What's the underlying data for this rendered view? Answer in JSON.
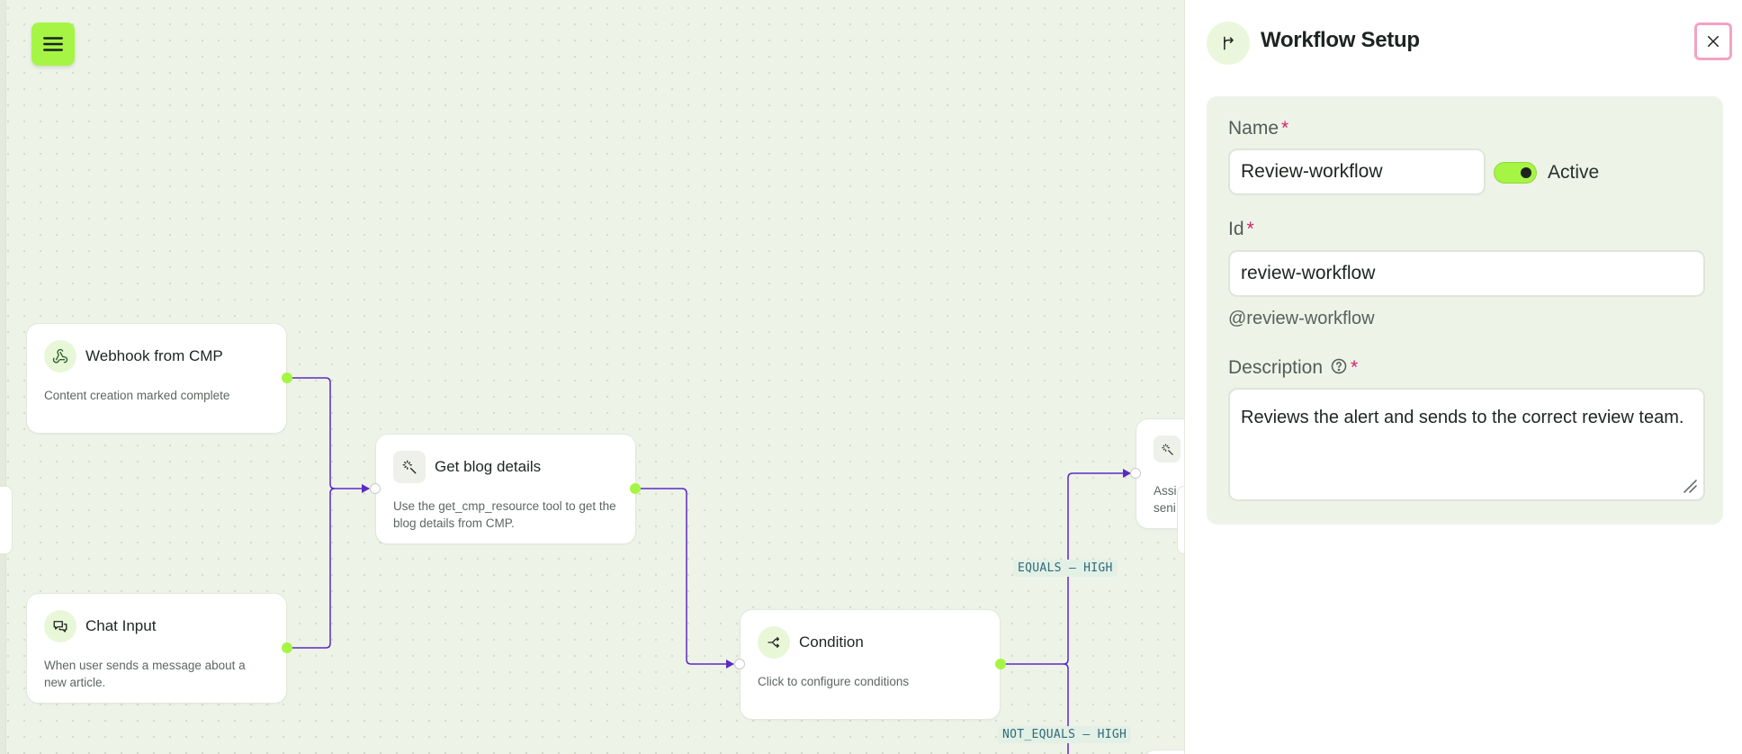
{
  "canvas": {
    "nodes": [
      {
        "id": "webhook",
        "title": "Webhook from CMP",
        "description": "Content creation marked complete",
        "icon": "webhook-icon"
      },
      {
        "id": "blog",
        "title": "Get blog details",
        "description": "Use the get_cmp_resource tool to get the blog details from CMP.",
        "icon": "wand-icon"
      },
      {
        "id": "chat",
        "title": "Chat Input",
        "description": "When user sends a message about a new article.",
        "icon": "chat-icon"
      },
      {
        "id": "condition",
        "title": "Condition",
        "description": "Click to configure conditions",
        "icon": "branch-icon"
      },
      {
        "id": "partial",
        "title": "",
        "description": "Assi… seni…",
        "icon": "wand-icon"
      }
    ],
    "edge_labels": [
      "EQUALS – HIGH",
      "NOT_EQUALS – HIGH"
    ],
    "partial_node_lines": [
      "Assi",
      "seni"
    ]
  },
  "panel": {
    "title": "Workflow Setup",
    "name_label": "Name",
    "name_value": "Review-workflow",
    "active_label": "Active",
    "active": true,
    "id_label": "Id",
    "id_value": "review-workflow",
    "handle": "@review-workflow",
    "description_label": "Description",
    "description_value": "Reviews the alert and sends to the correct review team.",
    "required_mark": "*"
  },
  "colors": {
    "accent_green": "#a6f545",
    "edge_purple": "#5b2bc4",
    "close_highlight": "#f3a3c4",
    "required": "#d0246a"
  }
}
